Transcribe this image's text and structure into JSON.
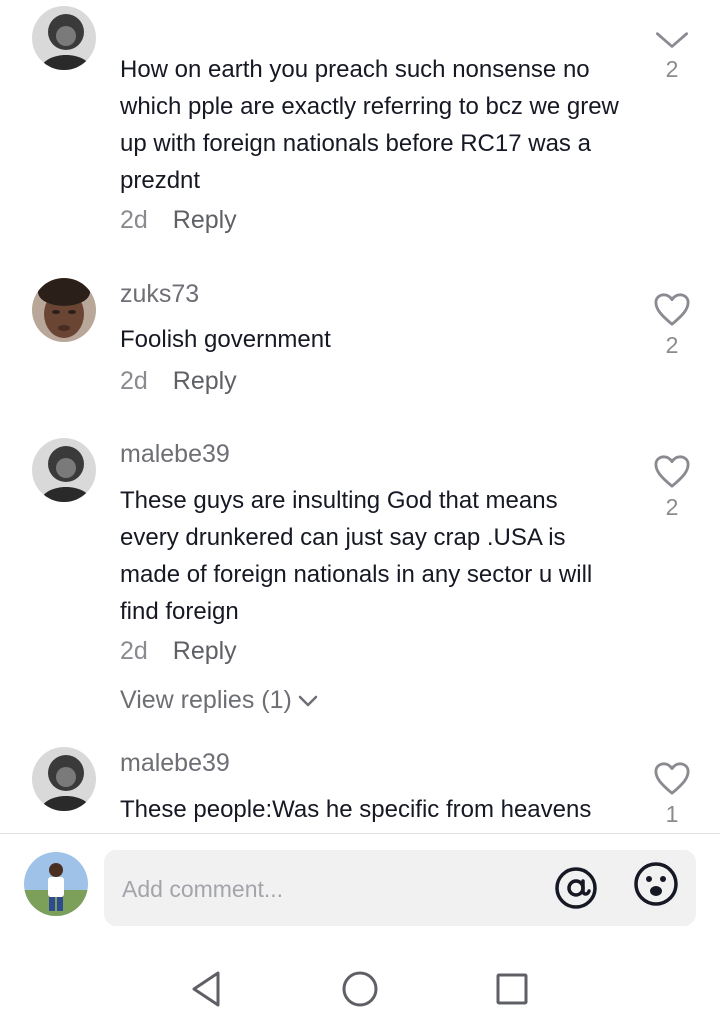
{
  "comments": [
    {
      "username": "",
      "text": "How on earth you preach such nonsense no which pple are exactly referring to bcz we grew up with foreign nationals before RC17 was a prezdnt",
      "time": "2d",
      "reply_label": "Reply",
      "likes": "2"
    },
    {
      "username": "zuks73",
      "text": "Foolish government",
      "time": "2d",
      "reply_label": "Reply",
      "likes": "2"
    },
    {
      "username": "malebe39",
      "text": "These guys are insulting God that means every drunkered can just say crap .USA is made of foreign nationals in any sector u will find foreign",
      "time": "2d",
      "reply_label": "Reply",
      "likes": "2",
      "view_replies": "View replies (1)"
    },
    {
      "username": "malebe39",
      "text": "These people:Was he specific from heavens",
      "likes": "1"
    }
  ],
  "input": {
    "placeholder": "Add comment..."
  },
  "icons": {
    "mention": "at-icon",
    "emoji": "emoji-icon",
    "like": "heart-icon",
    "back": "nav-back-icon",
    "home": "nav-home-icon",
    "recents": "nav-recents-icon"
  }
}
